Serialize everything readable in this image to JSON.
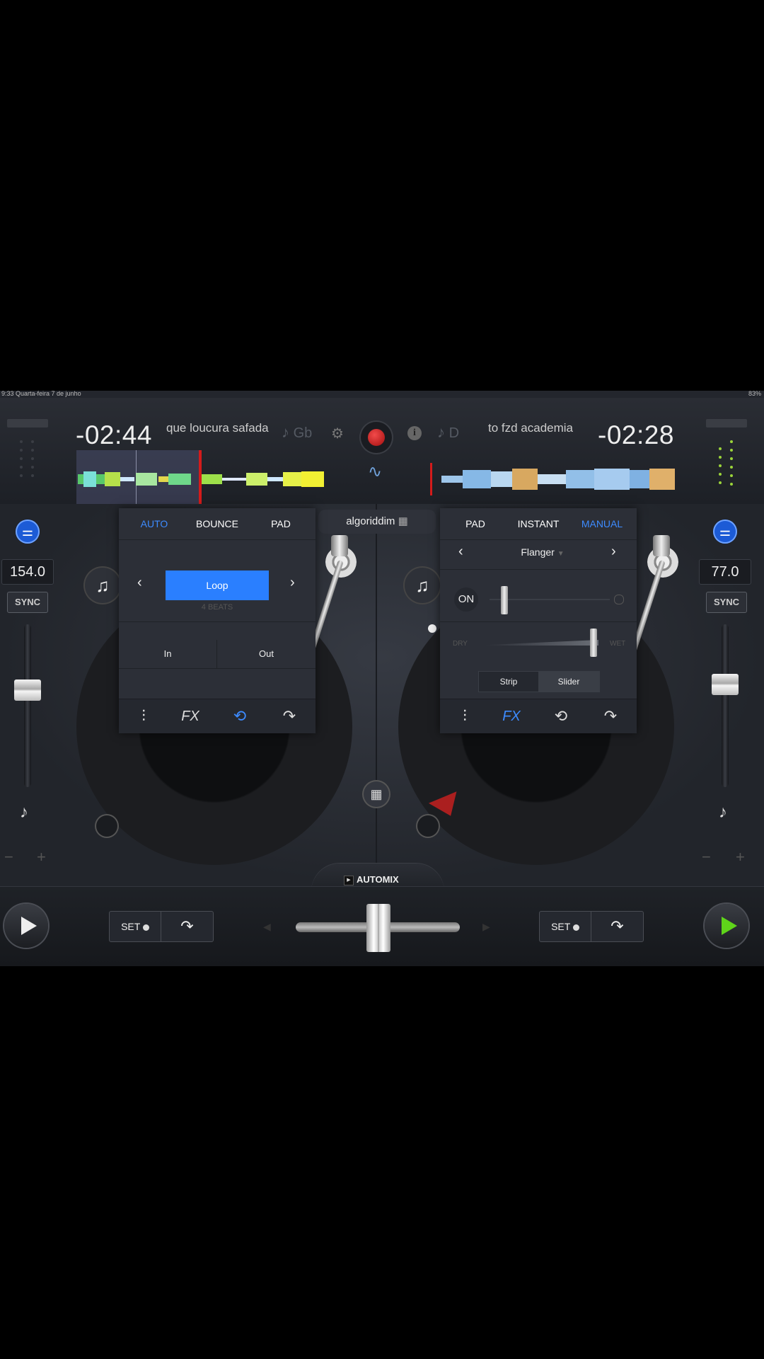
{
  "status_bar": {
    "left": "9:33 Quarta-feira 7 de junho",
    "right": "83%"
  },
  "deck_a": {
    "time_remaining": "-02:44",
    "track_title": "que loucura safada",
    "key": "Gb",
    "bpm": "154.0",
    "sync_label": "SYNC",
    "panel": {
      "tabs": [
        "AUTO",
        "BOUNCE",
        "PAD"
      ],
      "active_tab": "AUTO",
      "loop_label": "Loop",
      "beats_label": "4 BEATS",
      "in_label": "In",
      "out_label": "Out",
      "fx_label": "FX"
    },
    "set_label": "SET"
  },
  "deck_b": {
    "time_remaining": "-02:28",
    "track_title": "to fzd academia",
    "key": "D",
    "bpm": "77.0",
    "sync_label": "SYNC",
    "panel": {
      "tabs": [
        "PAD",
        "INSTANT",
        "MANUAL"
      ],
      "active_tab": "MANUAL",
      "effect_name": "Flanger",
      "on_label": "ON",
      "dry_label": "DRY",
      "wet_label": "WET",
      "strip_label": "Strip",
      "slider_label": "Slider",
      "fx_label": "FX"
    },
    "set_label": "SET"
  },
  "center": {
    "brand": "algoriddim",
    "automix_label": "AUTOMIX"
  },
  "colors": {
    "accent": "#3d8bff",
    "record": "#d41b1b",
    "play_b": "#5fd41a"
  }
}
